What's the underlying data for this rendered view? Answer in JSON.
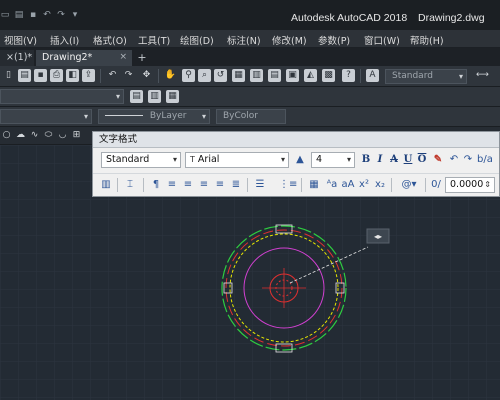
{
  "titlebar": {
    "app_name": "Autodesk AutoCAD 2018",
    "file_name": "Drawing2.dwg"
  },
  "menu": {
    "items": [
      "视图(V)",
      "插入(I)",
      "格式(O)",
      "工具(T)",
      "绘图(D)",
      "标注(N)",
      "修改(M)",
      "参数(P)",
      "窗口(W)",
      "帮助(H)"
    ]
  },
  "tabs": [
    {
      "label": "×(1)*"
    },
    {
      "label": "Drawing2*"
    }
  ],
  "toolbar": {
    "text_style_value": "Standard",
    "linetype_value": "ByLayer",
    "lineweight_value": "ByLayer",
    "plot_color_value": "ByColor"
  },
  "text_format_panel": {
    "title": "文字格式",
    "style_value": "Standard",
    "font_value": "Arial",
    "height_value": "4",
    "bold_label": "B",
    "italic_label": "I",
    "strike_label": "A",
    "underline_label": "U",
    "overline_label": "O",
    "oblique_value": "0/",
    "oblique_angle_value": "0.0000",
    "at_label": "@▾"
  },
  "icons": {
    "quick_access": [
      "new-icon",
      "open-icon",
      "save-icon",
      "undo-icon",
      "redo-icon"
    ],
    "tab_add": "plus-icon"
  },
  "colors": {
    "canvas_bg": "#232b34",
    "panel_bg": "#f0f0f0",
    "drawing_red": "#e03030",
    "drawing_green": "#2ecc40",
    "drawing_yellow": "#e6e600",
    "drawing_magenta": "#d040d0",
    "drawing_white": "#e8e8e8"
  }
}
